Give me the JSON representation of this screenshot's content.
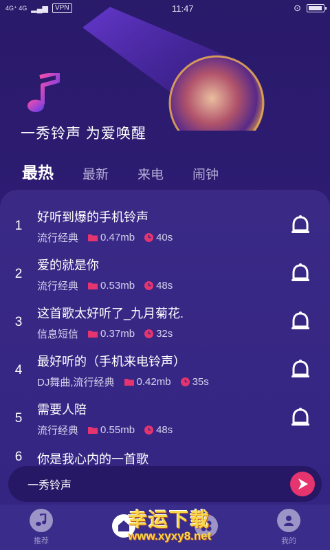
{
  "status_bar": {
    "network": "4G⁺ 4G",
    "vpn": "VPN",
    "time": "11:47"
  },
  "header": {
    "slogan": "一秀铃声 为爱唤醒",
    "tabs": [
      {
        "label": "最热",
        "active": true
      },
      {
        "label": "最新",
        "active": false
      },
      {
        "label": "来电",
        "active": false
      },
      {
        "label": "闹钟",
        "active": false
      }
    ]
  },
  "songs": [
    {
      "rank": "1",
      "title": "好听到爆的手机铃声",
      "category": "流行经典",
      "size": "0.47mb",
      "duration": "40s"
    },
    {
      "rank": "2",
      "title": "爱的就是你",
      "category": "流行经典",
      "size": "0.53mb",
      "duration": "48s"
    },
    {
      "rank": "3",
      "title": "这首歌太好听了_九月菊花.",
      "category": "信息短信",
      "size": "0.37mb",
      "duration": "32s"
    },
    {
      "rank": "4",
      "title": "最好听的（手机来电铃声）",
      "category": "DJ舞曲,流行经典",
      "size": "0.42mb",
      "duration": "35s"
    },
    {
      "rank": "5",
      "title": "需要人陪",
      "category": "流行经典",
      "size": "0.55mb",
      "duration": "48s"
    },
    {
      "rank": "6",
      "title": "你是我心内的一首歌",
      "category": "",
      "size": "",
      "duration": ""
    }
  ],
  "player": {
    "title": "一秀铃声"
  },
  "bottom_nav": [
    {
      "label": "推荐",
      "icon": "music-note-icon",
      "active": false
    },
    {
      "label": "",
      "icon": "home-icon",
      "active": true
    },
    {
      "label": "",
      "icon": "category-icon",
      "active": false
    },
    {
      "label": "我的",
      "icon": "user-icon",
      "active": false
    }
  ],
  "watermark": {
    "line1": "幸运下载",
    "line2": "www.xyxy8.net"
  },
  "colors": {
    "background": "#2b1a6e",
    "panel": "#3a2a86",
    "accent_pink": "#e5346e",
    "accent_purple": "#9a3cf0"
  }
}
